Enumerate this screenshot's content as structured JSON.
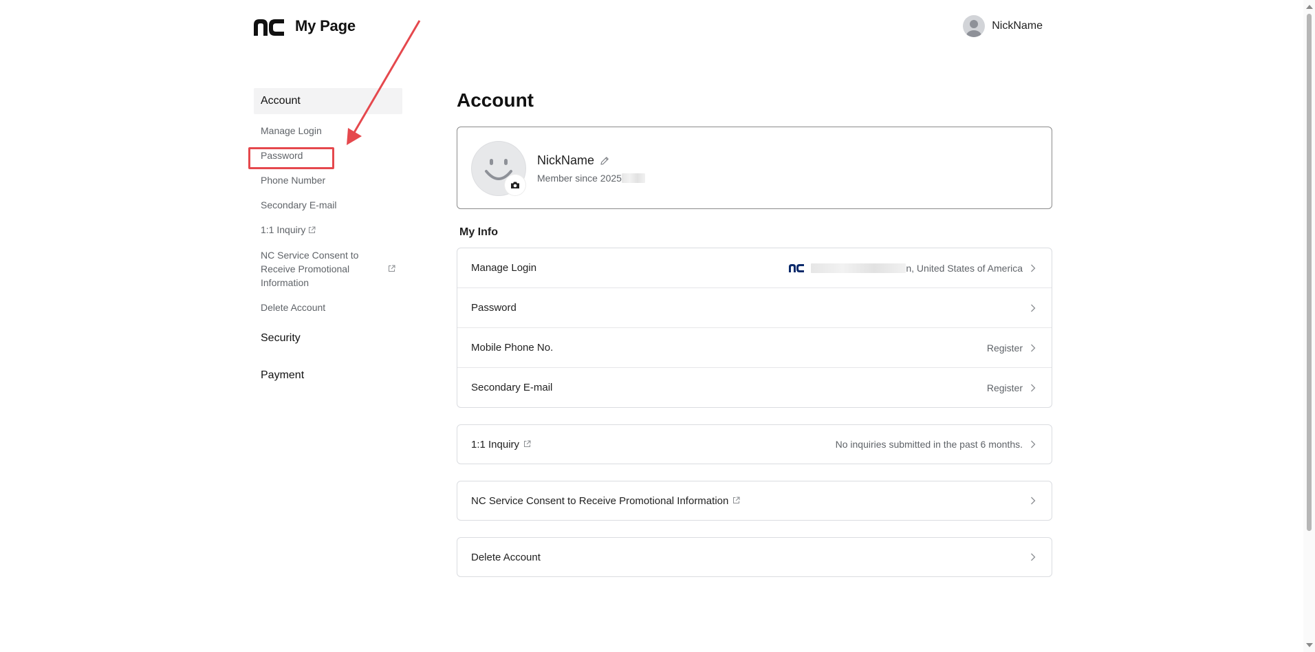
{
  "header": {
    "brand_title": "My Page",
    "user_name": "NickName"
  },
  "sidebar": {
    "account_label": "Account",
    "account_items": [
      {
        "label": "Manage Login"
      },
      {
        "label": "Password"
      },
      {
        "label": "Phone Number"
      },
      {
        "label": "Secondary E-mail"
      },
      {
        "label": "1:1 Inquiry"
      },
      {
        "label": "NC Service Consent to Receive Promotional Information"
      },
      {
        "label": "Delete Account"
      }
    ],
    "security_label": "Security",
    "payment_label": "Payment"
  },
  "main": {
    "title": "Account",
    "profile": {
      "name": "NickName",
      "member_since": "Member since 2025"
    },
    "my_info_label": "My Info",
    "my_info_rows": [
      {
        "label": "Manage Login",
        "value": "n, United States of America"
      },
      {
        "label": "Password",
        "value": ""
      },
      {
        "label": "Mobile Phone No.",
        "value": "Register"
      },
      {
        "label": "Secondary E-mail",
        "value": "Register"
      }
    ],
    "inquiry": {
      "label": "1:1 Inquiry",
      "value": "No inquiries submitted in the past 6 months."
    },
    "consent": {
      "label": "NC Service Consent to Receive Promotional Information"
    },
    "delete": {
      "label": "Delete Account"
    }
  },
  "colors": {
    "annotation": "#e5484d",
    "brand": "#0b2a6b",
    "active_bg": "#f3f3f4"
  },
  "icons": {
    "logo": "nc-logo",
    "user_avatar": "avatar",
    "profile_avatar": "smiley-avatar",
    "camera": "camera-icon",
    "edit": "pencil-icon",
    "external": "external-link-icon",
    "chevron": "chevron-right-icon"
  }
}
